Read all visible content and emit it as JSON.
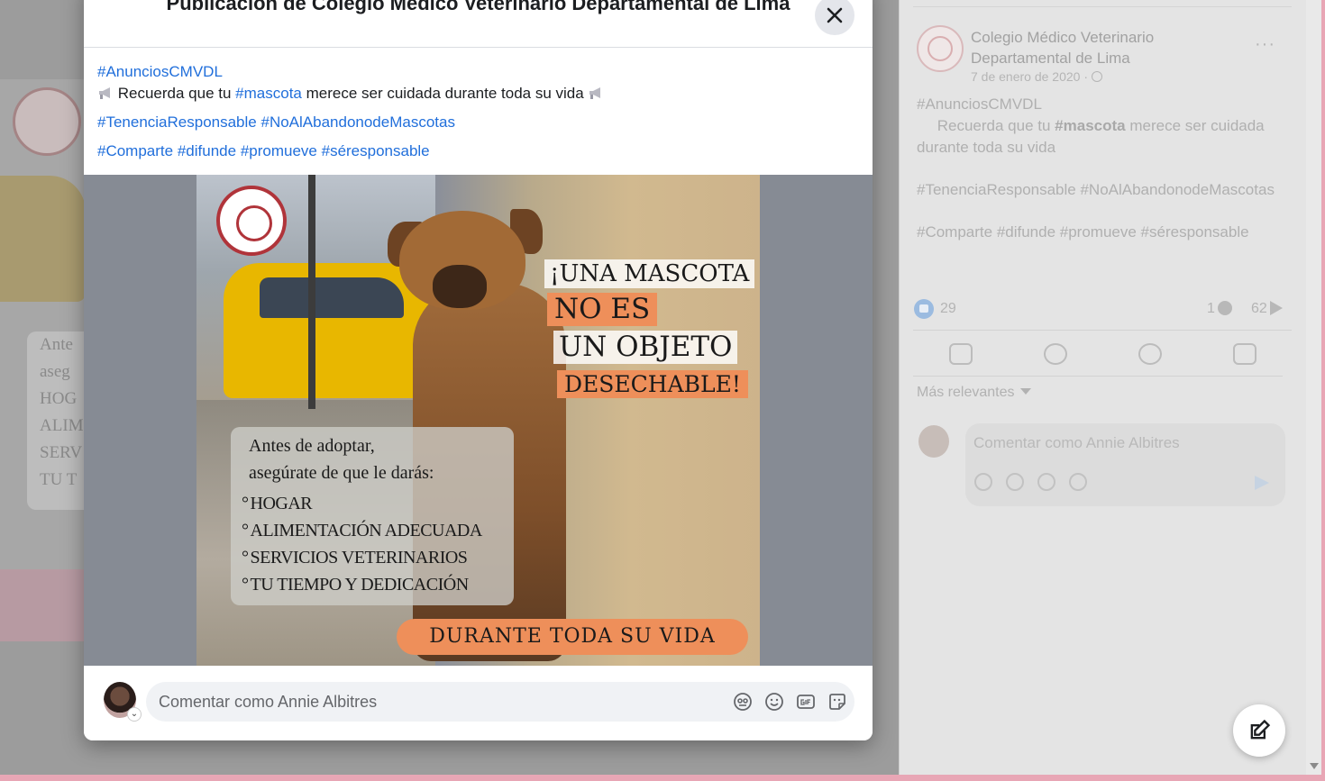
{
  "modal": {
    "title": "Publicación de Colegio Médico Veterinario Departamental de Lima",
    "close_icon": "close-icon",
    "post": {
      "hashtag_line1": "#AnunciosCMVDL",
      "line2_prefix": "Recuerda que tu",
      "line2_tag": "#mascota",
      "line2_suffix": "merece ser cuidada durante toda su vida",
      "tag_tenencia": "#TenenciaResponsable",
      "tag_noabandono": "#NoAlAbandonodeMascotas",
      "tag_comparte": "#Comparte",
      "tag_difunde": "#difunde",
      "tag_promueve": "#promueve",
      "tag_seresponsable": "#séresponsable",
      "emoji": "megaphone-icon"
    },
    "image": {
      "headline1": "¡UNA MASCOTA",
      "headline2": "NO ES",
      "headline3": "UN OBJETO",
      "headline4": "DESECHABLE!",
      "box_line1": "Antes de adoptar,",
      "box_line2": "asegúrate de que le darás:",
      "items": [
        "HOGAR",
        "ALIMENTACIÓN ADECUADA",
        "SERVICIOS VETERINARIOS",
        "TU TIEMPO Y DEDICACIÓN"
      ],
      "banner": "DURANTE TODA SU VIDA"
    },
    "comment": {
      "placeholder": "Comentar como Annie Albitres",
      "icons": [
        "avatar-sticker-icon",
        "emoji-icon",
        "gif-icon",
        "sticker-icon"
      ]
    }
  },
  "side_panel": {
    "page_name": "Colegio Médico Veterinario Departamental de Lima",
    "date": "7 de enero de 2020 ·",
    "more": "···",
    "text_tag1": "#AnunciosCMVDL",
    "text_line2_prefix": "Recuerda que tu",
    "text_line2_tag": "#mascota",
    "text_line2_suffix": "merece ser cuidada durante toda su vida",
    "text_tags2": "#TenenciaResponsable #NoAlAbandonodeMascotas",
    "text_tags3": "#Comparte #difunde #promueve #séresponsable",
    "likes": "29",
    "comments": "1",
    "shares": "62",
    "sort_label": "Más relevantes",
    "comment_placeholder": "Comentar como Annie Albitres"
  },
  "background": {
    "card_lines": [
      "Ante",
      "aseg",
      "HOG",
      "ALIM",
      "SERV",
      "TU T"
    ]
  },
  "colors": {
    "link": "#216fdb",
    "orange_label": "#ee8f5a",
    "logo_red": "#b0343a"
  }
}
